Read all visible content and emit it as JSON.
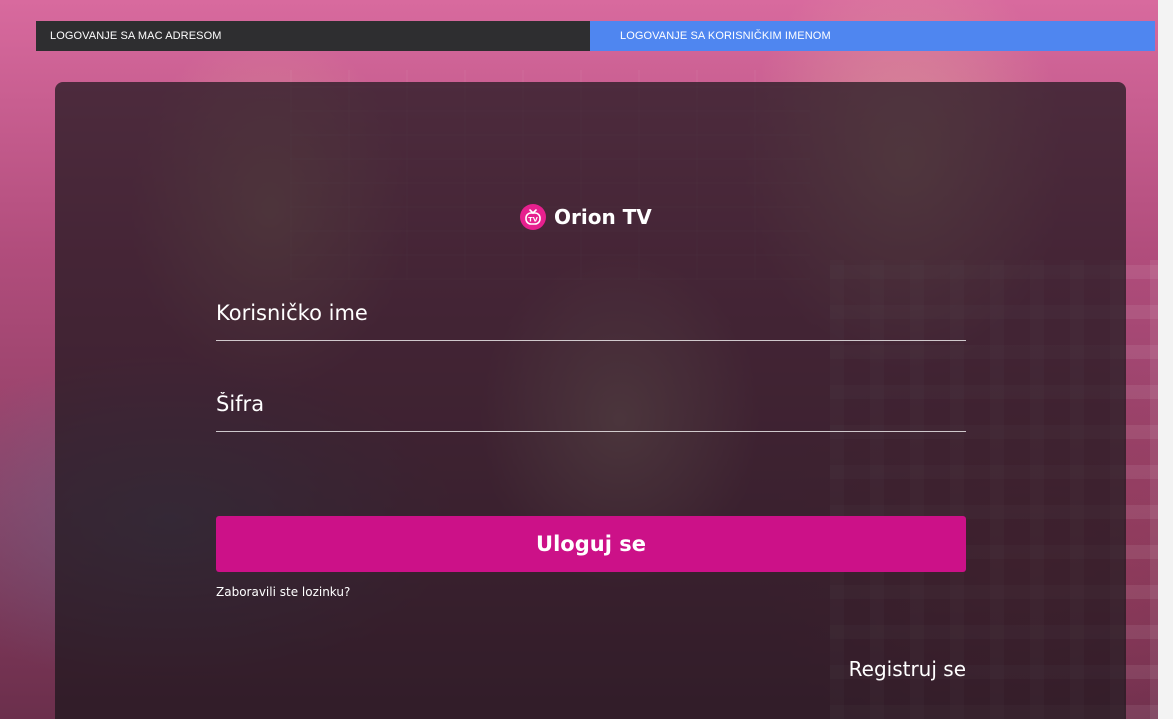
{
  "tabs": {
    "mac_label": "LOGOVANJE SA MAC ADRESOM",
    "username_label": "LOGOVANJE SA KORISNIČKIM IMENOM"
  },
  "brand": {
    "name": "Orion TV",
    "icon": "tv-icon",
    "icon_text": "TV",
    "accent_color": "#cc1188",
    "tab_active_color": "#4f86f0",
    "tab_inactive_color": "#2e2e30"
  },
  "form": {
    "username_placeholder": "Korisničko ime",
    "password_placeholder": "Šifra",
    "submit_label": "Uloguj se",
    "forgot_label": "Zaboravili ste lozinku?",
    "register_label": "Registruj se"
  }
}
